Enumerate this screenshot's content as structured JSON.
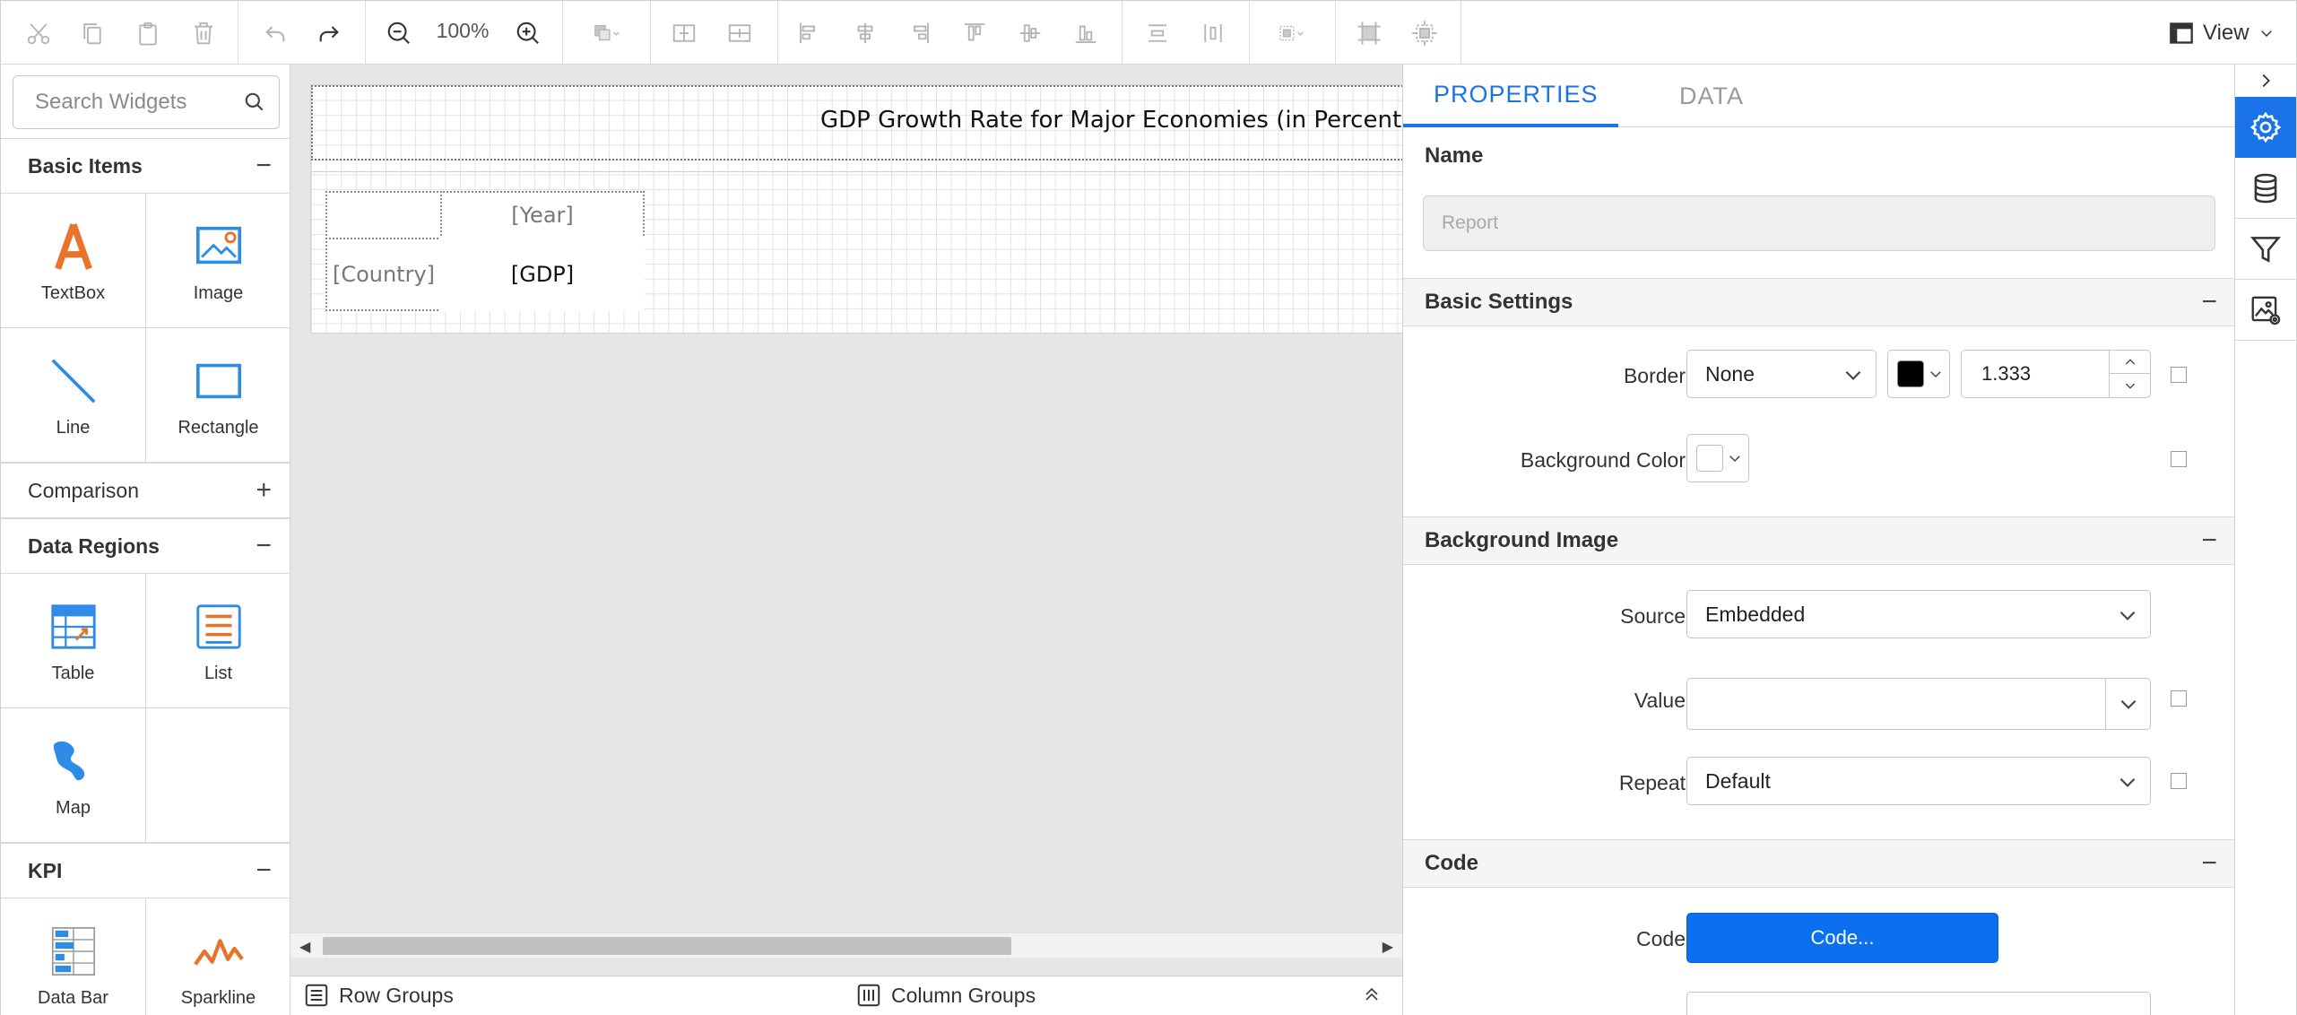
{
  "toolbar": {
    "zoom": "100%",
    "view_label": "View",
    "icons": [
      "cut-icon",
      "copy-icon",
      "paste-icon",
      "delete-icon",
      "undo-icon",
      "redo-icon",
      "zoom-out-icon",
      "zoom-in-icon",
      "arrange-icon",
      "insert-row-icon",
      "insert-col-icon",
      "align-left-icon",
      "align-center-icon",
      "align-right-icon",
      "align-top-icon",
      "align-middle-icon",
      "align-bottom-icon",
      "distribute-h-icon",
      "distribute-v-icon",
      "group-icon",
      "size-fit-icon",
      "size-all-icon"
    ]
  },
  "widgets": {
    "search_placeholder": "Search Widgets",
    "sections": {
      "basic": "Basic Items",
      "comparison": "Comparison",
      "data_regions": "Data Regions",
      "kpi": "KPI"
    },
    "expanded_symbol": "−",
    "collapsed_symbol": "+",
    "items": {
      "textbox": "TextBox",
      "image": "Image",
      "line": "Line",
      "rectangle": "Rectangle",
      "table": "Table",
      "list": "List",
      "map": "Map",
      "databar": "Data Bar",
      "sparkline": "Sparkline"
    }
  },
  "design": {
    "title": "GDP Growth Rate for Major Economies (in Percentage)",
    "matrix": {
      "col_header": "[Year]",
      "row_header": "[Country]",
      "cell": "[GDP]"
    }
  },
  "groups": {
    "row": "Row Groups",
    "column": "Column Groups"
  },
  "properties": {
    "tabs": [
      "PROPERTIES",
      "DATA"
    ],
    "name_label": "Name",
    "name_placeholder": "Report",
    "sections": {
      "basic_settings": "Basic Settings",
      "background_image": "Background Image",
      "code": "Code"
    },
    "border_label": "Border",
    "border_style": "None",
    "border_color": "#000000",
    "border_width": "1.333",
    "bg_color_label": "Background Color",
    "source_label": "Source",
    "source_value": "Embedded",
    "value_label": "Value",
    "repeat_label": "Repeat",
    "repeat_value": "Default",
    "code_label": "Code",
    "code_button": "Code..."
  },
  "colors": {
    "accent": "#1a73e8",
    "code_button": "#0b6ff0",
    "textbox_icon": "#e8742c",
    "icon_blue": "#2e8be6"
  }
}
